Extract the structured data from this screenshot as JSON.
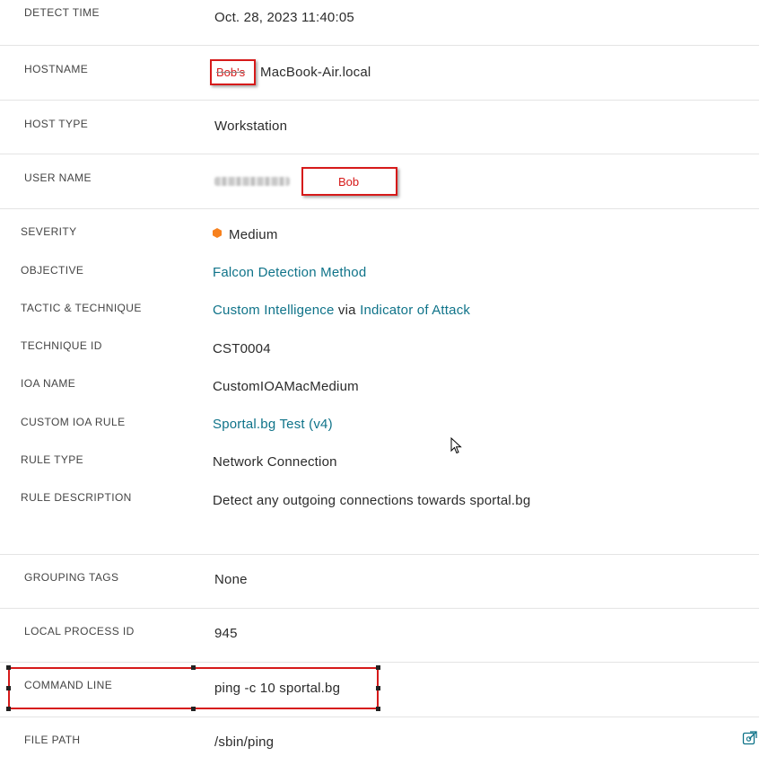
{
  "fields": {
    "detect_time": {
      "label": "DETECT TIME",
      "value": "Oct. 28, 2023 11:40:05"
    },
    "hostname": {
      "label": "HOSTNAME",
      "value_redacted_overlay": "Bob's",
      "value_suffix": "MacBook-Air.local"
    },
    "host_type": {
      "label": "HOST TYPE",
      "value": "Workstation"
    },
    "user_name": {
      "label": "USER NAME",
      "overlay": "Bob"
    },
    "severity": {
      "label": "SEVERITY",
      "value": "Medium",
      "color": "#f7811e"
    },
    "objective": {
      "label": "OBJECTIVE",
      "value": "Falcon Detection Method"
    },
    "tactic": {
      "label": "TACTIC & TECHNIQUE",
      "tactic": "Custom Intelligence",
      "via": "via",
      "technique": "Indicator of Attack"
    },
    "technique_id": {
      "label": "TECHNIQUE ID",
      "value": "CST0004"
    },
    "ioa_name": {
      "label": "IOA NAME",
      "value": "CustomIOAMacMedium"
    },
    "custom_ioa_rule": {
      "label": "CUSTOM IOA RULE",
      "value": "Sportal.bg Test (v4)"
    },
    "rule_type": {
      "label": "RULE TYPE",
      "value": "Network Connection"
    },
    "rule_description": {
      "label": "RULE DESCRIPTION",
      "value": "Detect any outgoing connections towards sportal.bg"
    },
    "grouping_tags": {
      "label": "GROUPING TAGS",
      "value": "None"
    },
    "local_process_id": {
      "label": "LOCAL PROCESS ID",
      "value": "945"
    },
    "command_line": {
      "label": "COMMAND LINE",
      "value": "ping -c 10 sportal.bg"
    },
    "file_path": {
      "label": "FILE PATH",
      "value": "/sbin/ping"
    }
  },
  "colors": {
    "link": "#0f7389",
    "annotation_red": "#d61a1a"
  },
  "icons": {
    "copy": "open-external-icon",
    "cursor": "mouse-pointer-icon"
  }
}
